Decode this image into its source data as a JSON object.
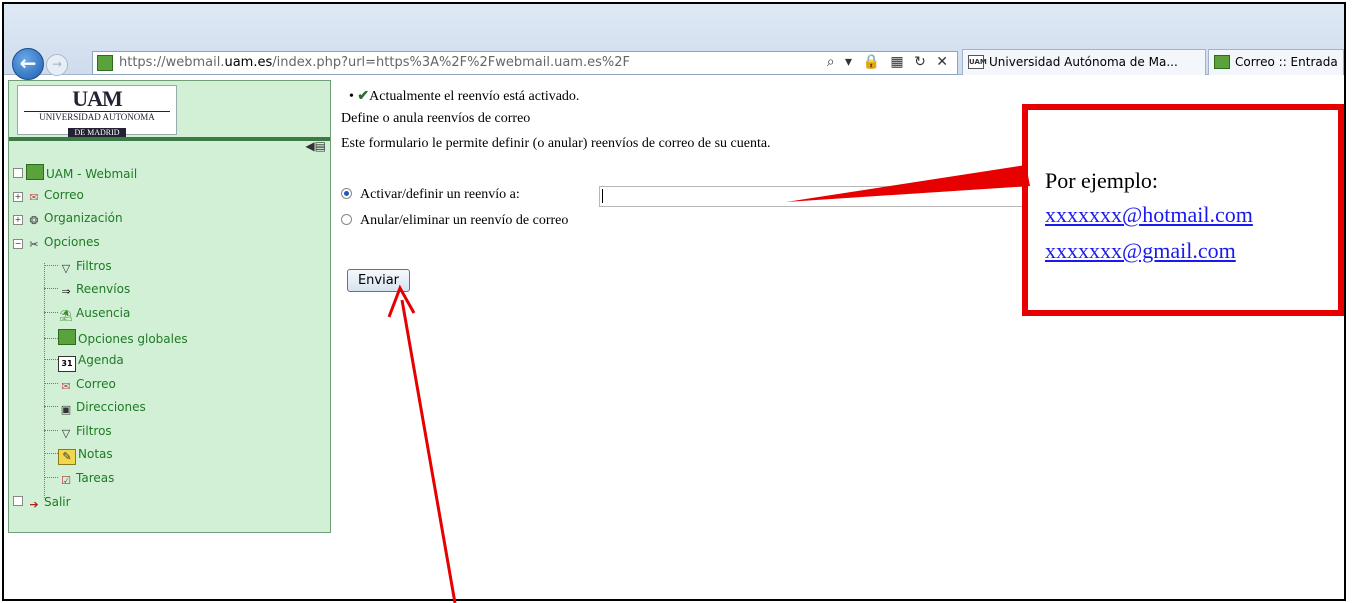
{
  "browser": {
    "url_prefix": "https://webmail.",
    "url_domain": "uam.es",
    "url_rest": "/index.php?url=https%3A%2F%2Fwebmail.uam.es%2F",
    "addr_icons": "⌕ ▾ 🔒 ▦ ↻ ✕",
    "tabs": [
      {
        "icon_text": "UAM",
        "label": "Universidad Autónoma de Ma..."
      },
      {
        "icon_text": "",
        "label": "Correo :: Entrada"
      }
    ]
  },
  "sidebar": {
    "logo_mark": "UAM",
    "logo_text": "UNIVERSIDAD AUTONOMA",
    "logo_sub": "DE MADRID",
    "items": [
      {
        "label": "UAM - Webmail",
        "icon": "webmail-icon"
      },
      {
        "label": "Correo",
        "icon": "mail-icon"
      },
      {
        "label": "Organización",
        "icon": "organization-icon"
      },
      {
        "label": "Opciones",
        "icon": "tools-icon"
      },
      {
        "label": "Filtros",
        "icon": "filter-icon"
      },
      {
        "label": "Reenvíos",
        "icon": "forward-arrow-icon"
      },
      {
        "label": "Ausencia",
        "icon": "vacation-icon"
      },
      {
        "label": "Opciones globales",
        "icon": "global-options-icon"
      },
      {
        "label": "Agenda",
        "icon": "calendar-icon"
      },
      {
        "label": "Correo",
        "icon": "mail-icon"
      },
      {
        "label": "Direcciones",
        "icon": "address-book-icon"
      },
      {
        "label": "Filtros",
        "icon": "filter-icon"
      },
      {
        "label": "Notas",
        "icon": "notes-icon"
      },
      {
        "label": "Tareas",
        "icon": "tasks-icon"
      },
      {
        "label": "Salir",
        "icon": "exit-icon"
      }
    ],
    "calendar_day": "31"
  },
  "content": {
    "status": "Actualmente el reenvío está activado.",
    "title": "Define o anula reenvíos de correo",
    "description": "Este formulario le permite definir (o anular) reenvíos de correo de su cuenta.",
    "option_activate": "Activar/definir un reenvío a:",
    "option_cancel": "Anular/eliminar un reenvío de correo",
    "input_value": "",
    "submit_label": "Enviar"
  },
  "callout": {
    "title": "Por ejemplo:",
    "email1": "xxxxxxx@hotmail.com",
    "email2": "xxxxxxx@gmail.com"
  },
  "colors": {
    "sidebar_bg": "#d2f0d6",
    "link_green": "#1f7a24",
    "annotation_red": "#e60000",
    "link_blue": "#1a1aee"
  }
}
